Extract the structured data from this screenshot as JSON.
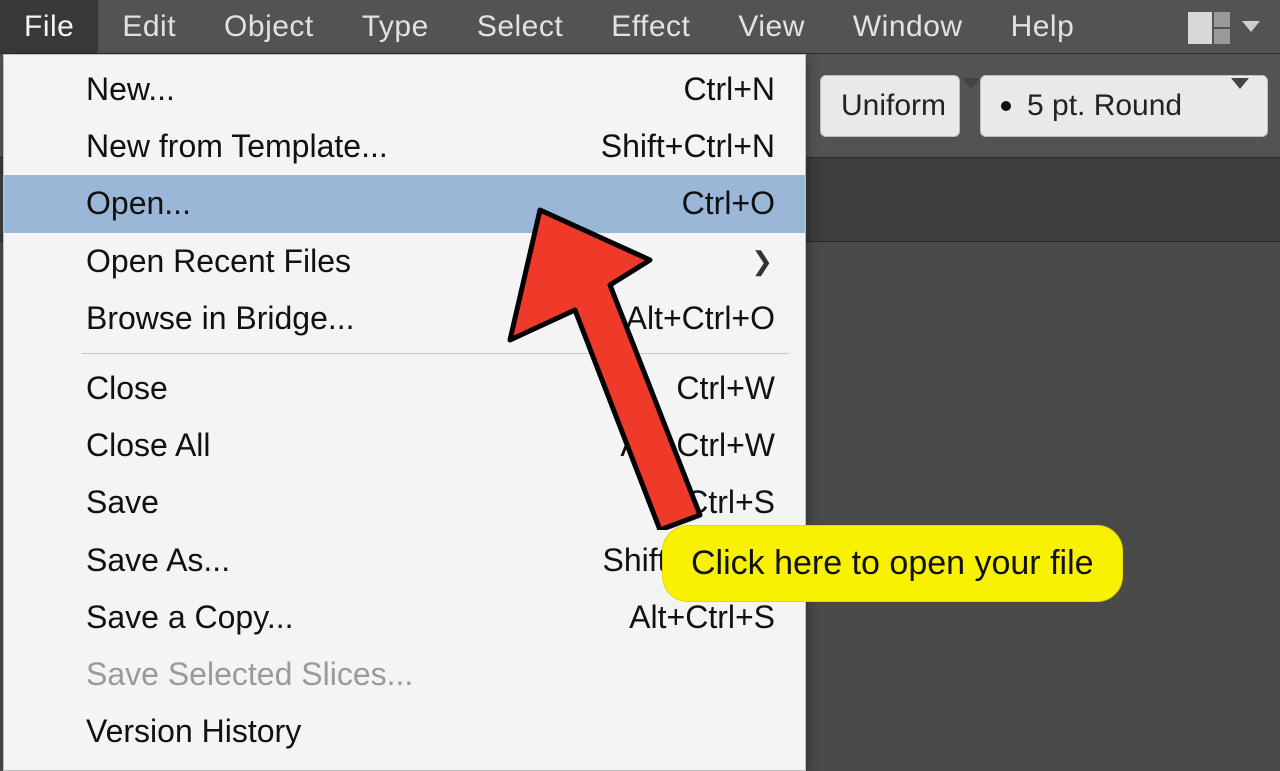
{
  "menuBar": {
    "items": [
      "File",
      "Edit",
      "Object",
      "Type",
      "Select",
      "Effect",
      "View",
      "Window",
      "Help"
    ],
    "activeIndex": 0
  },
  "optionBar": {
    "strokeStyle": {
      "label": "Uniform"
    },
    "strokeBrush": {
      "label": "5 pt. Round"
    }
  },
  "fileMenu": {
    "items": [
      {
        "label": "New...",
        "shortcut": "Ctrl+N"
      },
      {
        "label": "New from Template...",
        "shortcut": "Shift+Ctrl+N"
      },
      {
        "label": "Open...",
        "shortcut": "Ctrl+O",
        "highlighted": true
      },
      {
        "label": "Open Recent Files",
        "submenu": true
      },
      {
        "label": "Browse in Bridge...",
        "shortcut": "Alt+Ctrl+O"
      },
      {
        "sep": true
      },
      {
        "label": "Close",
        "shortcut": "Ctrl+W"
      },
      {
        "label": "Close All",
        "shortcut": "Alt+Ctrl+W"
      },
      {
        "label": "Save",
        "shortcut": "Ctrl+S"
      },
      {
        "label": "Save As...",
        "shortcut": "Shift+Ctrl+S"
      },
      {
        "label": "Save a Copy...",
        "shortcut": "Alt+Ctrl+S"
      },
      {
        "label": "Save Selected Slices...",
        "disabled": true
      },
      {
        "label": "Version History"
      }
    ]
  },
  "annotation": {
    "callout": "Click here to open your file"
  }
}
